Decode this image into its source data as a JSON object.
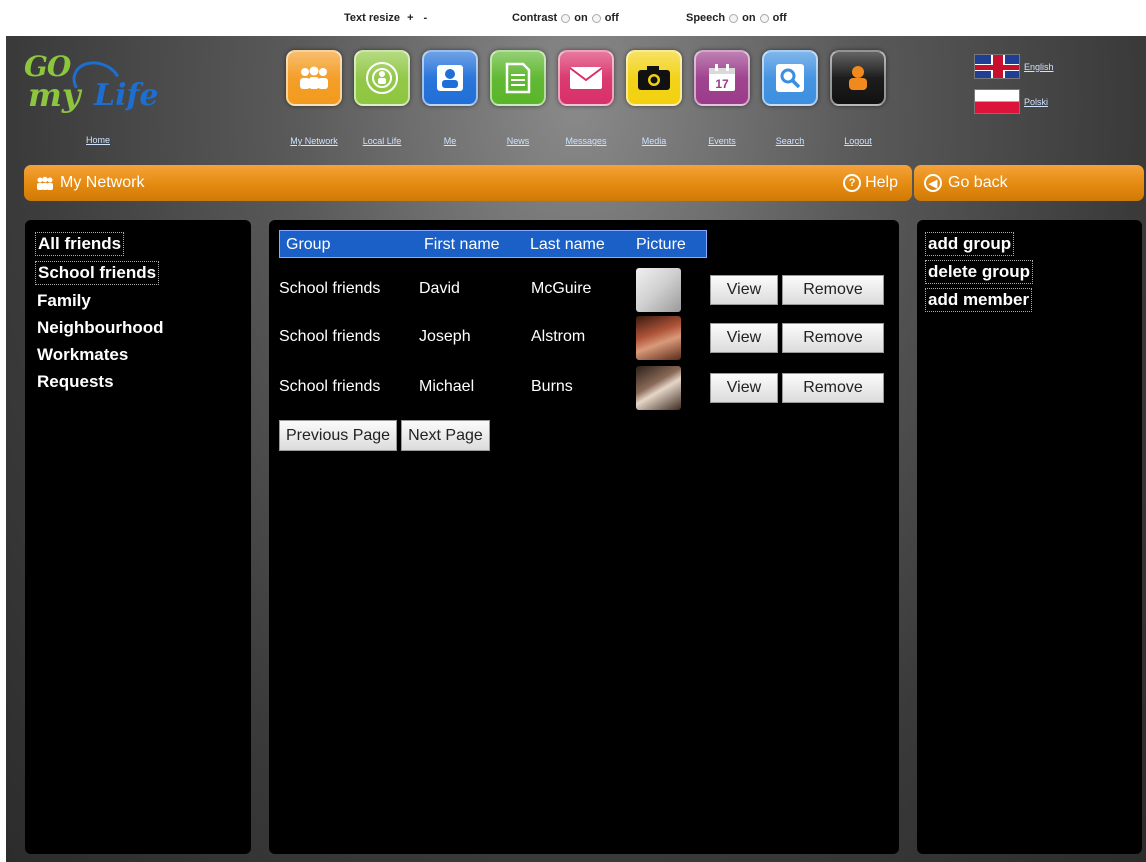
{
  "accessibility": {
    "text_resize_label": "Text resize",
    "text_resize_plus": "+",
    "text_resize_minus": "-",
    "contrast_label": "Contrast",
    "contrast_on": "on",
    "contrast_off": "off",
    "speech_label": "Speech",
    "speech_on": "on",
    "speech_off": "off"
  },
  "header": {
    "home_label": "Home",
    "nav": [
      {
        "label": "My Network",
        "icon": "people-icon",
        "color": "#f39a1e"
      },
      {
        "label": "Local Life",
        "icon": "target-icon",
        "color": "#8dc63f"
      },
      {
        "label": "Me",
        "icon": "person-icon",
        "color": "#1f6fd8"
      },
      {
        "label": "News",
        "icon": "document-icon",
        "color": "#5ab52a"
      },
      {
        "label": "Messages",
        "icon": "envelope-icon",
        "color": "#d9306a"
      },
      {
        "label": "Media",
        "icon": "camera-icon",
        "color": "#f2d10e"
      },
      {
        "label": "Events",
        "icon": "calendar-icon",
        "color": "#9b3b8a"
      },
      {
        "label": "Search",
        "icon": "magnifier-icon",
        "color": "#3c8fe0"
      },
      {
        "label": "Logout",
        "icon": "logout-person-icon",
        "color": "#111111"
      }
    ],
    "languages": [
      {
        "label": "English",
        "flag": "uk-flag-icon"
      },
      {
        "label": "Polski",
        "flag": "poland-flag-icon"
      }
    ]
  },
  "title_bar": {
    "title": "My Network",
    "help_label": "Help",
    "go_back_label": "Go back"
  },
  "groups": [
    "All friends",
    "School friends",
    "Family",
    "Neighbourhood",
    "Workmates",
    "Requests"
  ],
  "actions": [
    "add group",
    "delete group",
    "add member"
  ],
  "table": {
    "headers": {
      "group": "Group",
      "first_name": "First name",
      "last_name": "Last name",
      "picture": "Picture"
    },
    "rows": [
      {
        "group": "School friends",
        "first_name": "David",
        "last_name": "McGuire",
        "view_label": "View",
        "remove_label": "Remove"
      },
      {
        "group": "School friends",
        "first_name": "Joseph",
        "last_name": "Alstrom",
        "view_label": "View",
        "remove_label": "Remove"
      },
      {
        "group": "School friends",
        "first_name": "Michael",
        "last_name": "Burns",
        "view_label": "View",
        "remove_label": "Remove"
      }
    ]
  },
  "pagination": {
    "previous_label": "Previous Page",
    "next_label": "Next Page"
  },
  "colors": {
    "accent": "#e48a10",
    "header_selected": "#1b60c6",
    "panel": "#000000"
  }
}
